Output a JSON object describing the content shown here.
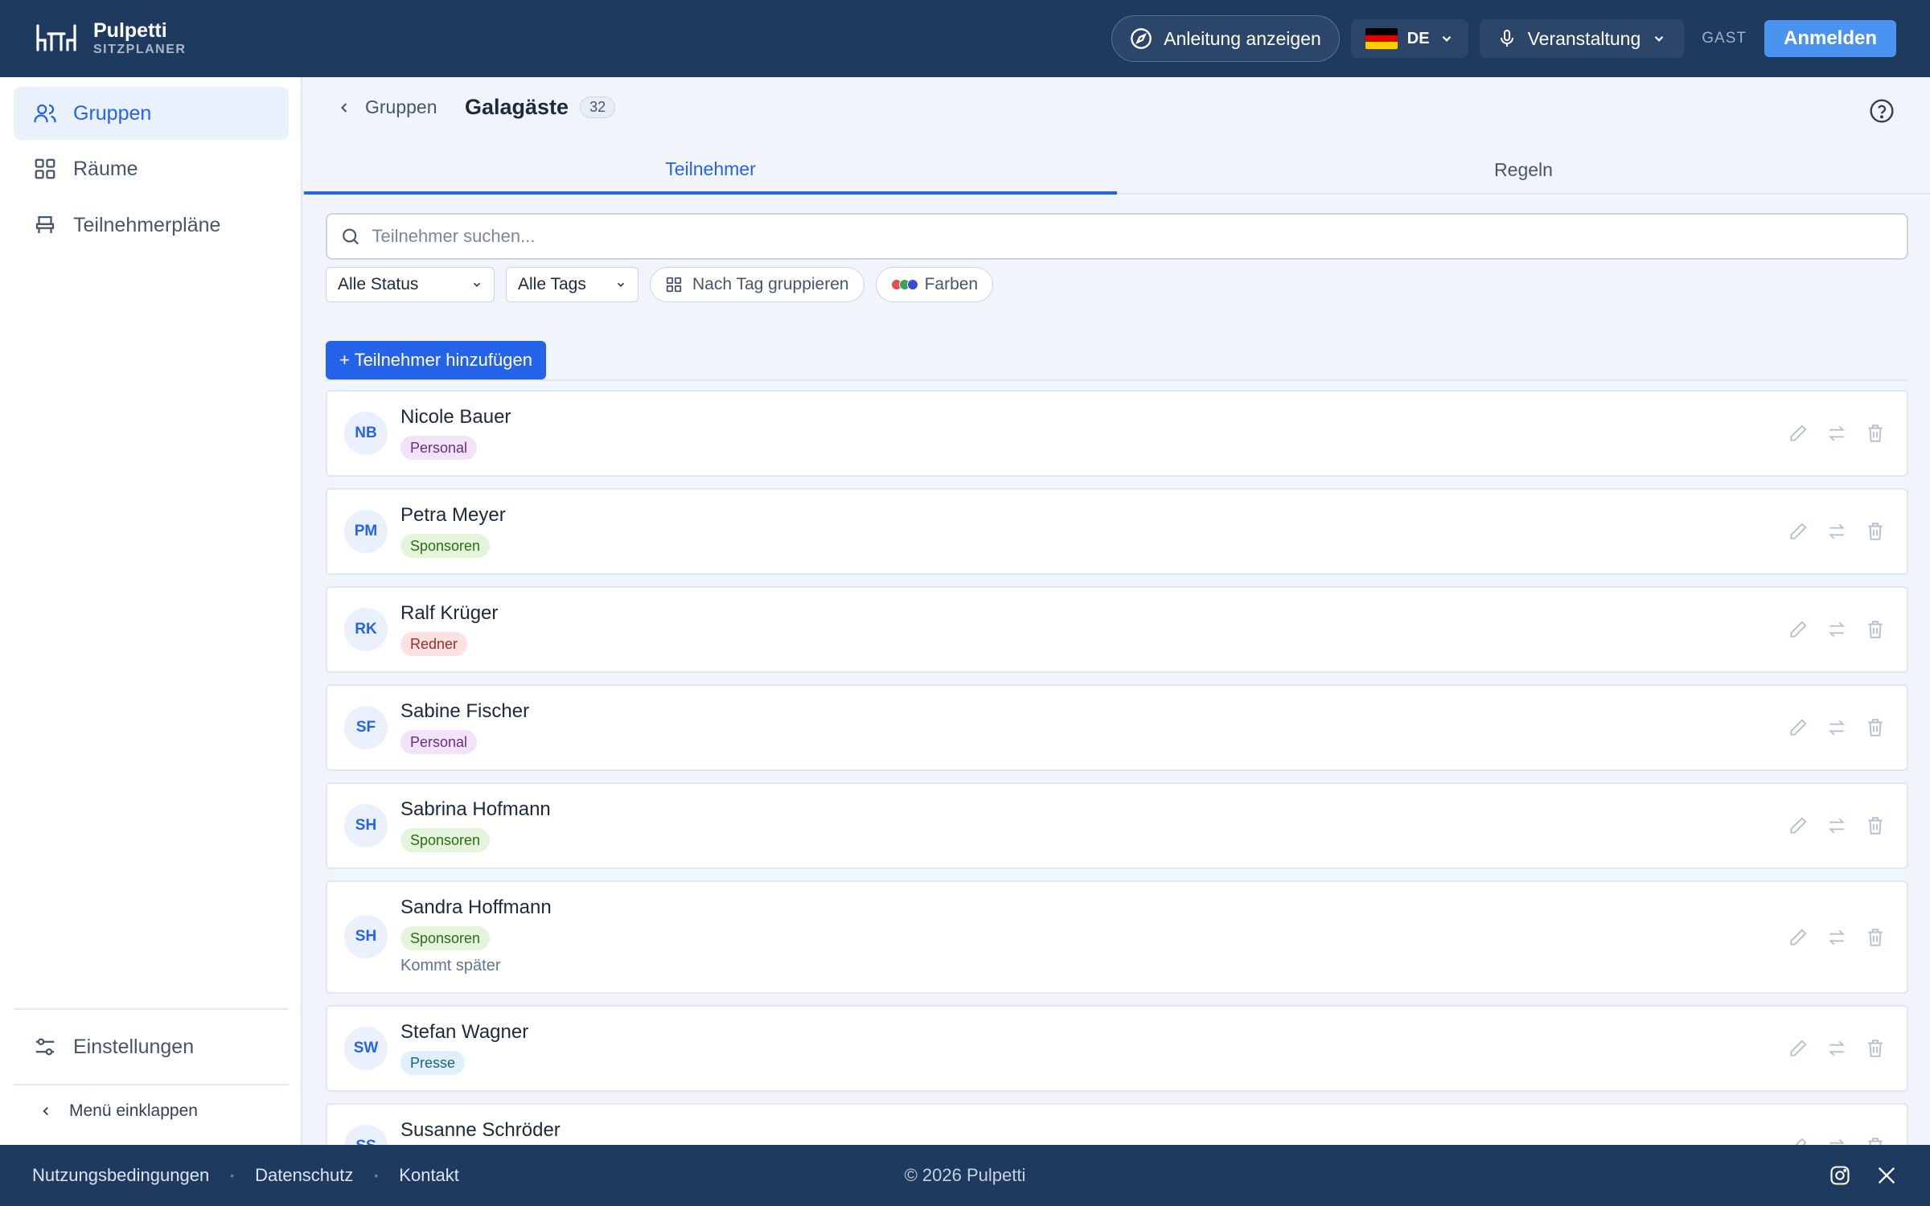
{
  "header": {
    "app_name": "Pulpetti",
    "app_sub": "SITZPLANER",
    "guide_label": "Anleitung anzeigen",
    "lang_code": "DE",
    "event_label": "Veranstaltung",
    "guest_label": "GAST",
    "login_label": "Anmelden"
  },
  "sidebar": {
    "items": [
      {
        "label": "Gruppen",
        "icon": "users-icon",
        "active": true
      },
      {
        "label": "Räume",
        "icon": "grid-icon",
        "active": false
      },
      {
        "label": "Teilnehmerpläne",
        "icon": "seat-icon",
        "active": false
      }
    ],
    "settings_label": "Einstellungen",
    "collapse_label": "Menü einklappen"
  },
  "main": {
    "back_label": "Gruppen",
    "group_title": "Galagäste",
    "group_count": "32",
    "tabs": [
      {
        "label": "Teilnehmer",
        "active": true
      },
      {
        "label": "Regeln",
        "active": false
      }
    ],
    "search_placeholder": "Teilnehmer suchen...",
    "filter_status": "Alle Status",
    "filter_tags": "Alle Tags",
    "group_by_tag_label": "Nach Tag gruppieren",
    "colors_label": "Farben",
    "add_label": "+ Teilnehmer hinzufügen"
  },
  "participants": [
    {
      "initials": "NB",
      "name": "Nicole Bauer",
      "tag": "Personal",
      "note": ""
    },
    {
      "initials": "PM",
      "name": "Petra Meyer",
      "tag": "Sponsoren",
      "note": ""
    },
    {
      "initials": "RK",
      "name": "Ralf Krüger",
      "tag": "Redner",
      "note": ""
    },
    {
      "initials": "SF",
      "name": "Sabine Fischer",
      "tag": "Personal",
      "note": ""
    },
    {
      "initials": "SH",
      "name": "Sabrina Hofmann",
      "tag": "Sponsoren",
      "note": ""
    },
    {
      "initials": "SH",
      "name": "Sandra Hoffmann",
      "tag": "Sponsoren",
      "note": "Kommt später"
    },
    {
      "initials": "SW",
      "name": "Stefan Wagner",
      "tag": "Presse",
      "note": ""
    },
    {
      "initials": "SS",
      "name": "Susanne Schröder",
      "tag": "",
      "note": ""
    }
  ],
  "footer": {
    "links": [
      "Nutzungsbedingungen",
      "Datenschutz",
      "Kontakt"
    ],
    "copyright": "© 2026 Pulpetti",
    "socials": [
      "instagram-icon",
      "x-icon"
    ]
  },
  "colors": {
    "header_bg": "#1f3a5f",
    "accent": "#2563eb",
    "login_bg": "#4a93f0",
    "color_dots": [
      "#e05252",
      "#3aa655",
      "#3b4bd8"
    ]
  }
}
